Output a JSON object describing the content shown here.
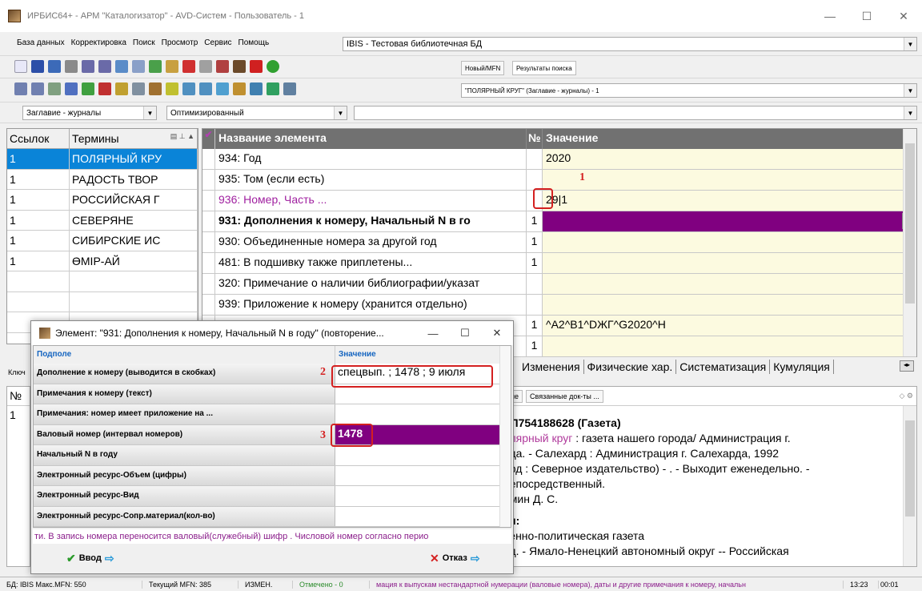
{
  "window": {
    "title": "ИРБИС64+ - АРМ \"Каталогизатор\" - AVD-Систем - Пользователь - 1"
  },
  "menu": [
    "База данных",
    "Корректировка",
    "Поиск",
    "Просмотр",
    "Сервис",
    "Помощь"
  ],
  "database_combo": "IBIS - Тестовая библиотечная БД",
  "top_tabs": [
    "Новый/MFN",
    "Результаты поиска"
  ],
  "search_result_combo": "\"ПОЛЯРНЫЙ КРУГ\" (Заглавие - журналы) - 1",
  "dictionary_combo": "Заглавие - журналы",
  "mode_combo": "Оптимизированный",
  "terms": {
    "headers": [
      "Ссылок",
      "Термины"
    ],
    "rows": [
      {
        "count": "1",
        "term": "ПОЛЯРНЫЙ КРУ"
      },
      {
        "count": "1",
        "term": "РАДОСТЬ ТВОР"
      },
      {
        "count": "1",
        "term": "РОССИЙСКАЯ Г"
      },
      {
        "count": "1",
        "term": "СЕВЕРЯНЕ"
      },
      {
        "count": "1",
        "term": "СИБИРСКИЕ ИС"
      },
      {
        "count": "1",
        "term": "ӨМІР-АЙ"
      }
    ],
    "key_label": "Ключ"
  },
  "fields": {
    "headers": {
      "name": "Название элемента",
      "num": "№",
      "value": "Значение"
    },
    "rows": [
      {
        "name": "934: Год",
        "num": "",
        "value": "2020"
      },
      {
        "name": "935: Том (если есть)",
        "num": "",
        "value": ""
      },
      {
        "name": "936: Номер, Часть ...",
        "num": "",
        "value": "29|1"
      },
      {
        "name": "931: Дополнения к номеру, Начальный N в го",
        "num": "1",
        "value": ""
      },
      {
        "name": "930: Объединенные номера за другой год",
        "num": "1",
        "value": ""
      },
      {
        "name": "481: В подшивку также приплетены...",
        "num": "1",
        "value": ""
      },
      {
        "name": "320: Примечание о наличии библиографии/указат",
        "num": "",
        "value": ""
      },
      {
        "name": "939: Приложение к номеру (хранится отдельно)",
        "num": "",
        "value": ""
      },
      {
        "name": "",
        "num": "1",
        "value": "^A2^B1^DЖГ^G2020^H"
      },
      {
        "name": "",
        "num": "1",
        "value": ""
      }
    ]
  },
  "lower_tabs": [
    "Изменения",
    "Физические хар.",
    "Систематизация",
    "Кумуляция"
  ],
  "bottom_tabs": [
    "ание",
    "Связанные док-ты ..."
  ],
  "bottom_text": {
    "heading": ": П754188628 (Газета)",
    "line1_mag": "олярный круг",
    "line1_rest": " : газета нашего города/ Администрация г.",
    "line2": "рда. - Салехард : Администрация г. Салехарда, 1992",
    "line3": "ард : Северное издательство) - . - Выходит еженедельно. -",
    "line4": "непосредственный.",
    "line5": "омин Д. С.",
    "line6": "ки:",
    "line7": "венно-политическая газета",
    "line8": "рд. - Ямало-Ненецкий автономный округ -- Российская"
  },
  "left_low": {
    "header": "№",
    "row": "1"
  },
  "status": {
    "db": "БД: IBIS Макс.MFN: 550",
    "mfn": "Текущий MFN: 385",
    "state": "ИЗМЕН.",
    "marked": "Отмечено - 0",
    "hint": "мация к выпускам нестандартной нумерации (валовые номера), даты и другие примечания к номеру, начальн",
    "time": "13:23",
    "clock": "00:01"
  },
  "dialog": {
    "title": "Элемент: \"931: Дополнения к номеру, Начальный N в году\" (повторение...",
    "headers": {
      "subfield": "Подполе",
      "value": "Значение"
    },
    "rows": [
      {
        "name": "Дополнение к номеру (выводится в скобках)",
        "value": "спецвып. ; 1478 ; 9 июля"
      },
      {
        "name": "Примечания к номеру (текст)",
        "value": ""
      },
      {
        "name": "Примечания: номер имеет приложение на ...",
        "value": ""
      },
      {
        "name": "Валовый номер (интервал номеров)",
        "value": "1478"
      },
      {
        "name": "Начальный N в году",
        "value": ""
      },
      {
        "name": "Электронный ресурс-Объем (цифры)",
        "value": ""
      },
      {
        "name": "Электронный ресурс-Вид",
        "value": ""
      },
      {
        "name": "Электронный ресурс-Сопр.материал(кол-во)",
        "value": ""
      }
    ],
    "hint": "ти. В запись номера переносится валовый(служебный) шифр .    Числовой номер согласно перио",
    "ok_label": "Ввод",
    "cancel_label": "Отказ"
  },
  "annotations": [
    "1",
    "2",
    "3"
  ],
  "colors": {
    "selection": "#0a84d8",
    "purple": "#800080",
    "header_gray": "#717171",
    "value_bg": "#fcfae0",
    "annotation_red": "#d42020"
  }
}
